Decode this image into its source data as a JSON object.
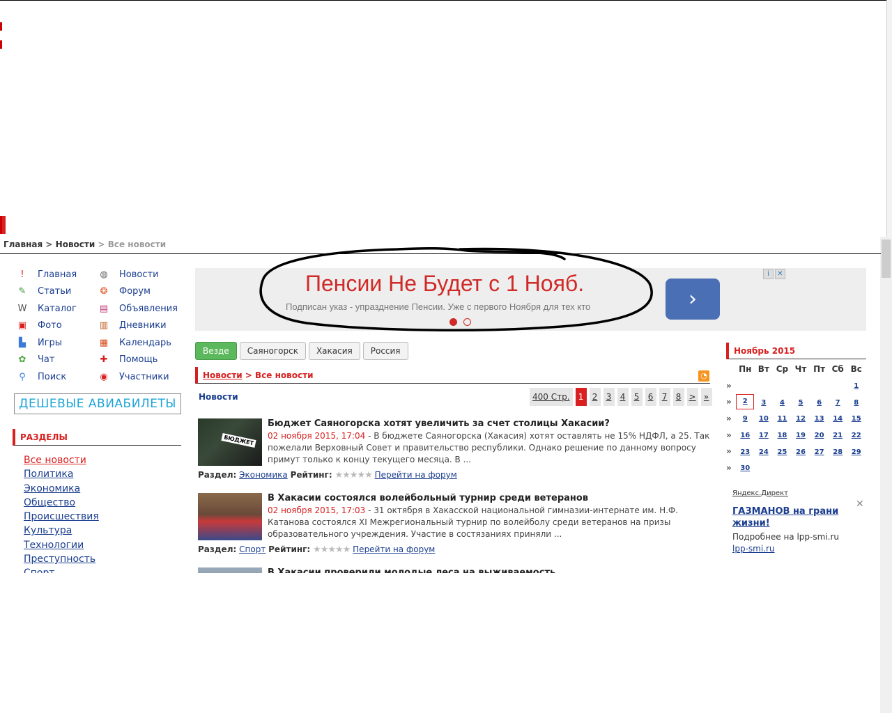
{
  "breadcrumb": {
    "home": "Главная",
    "sep1": ">",
    "news": "Новости",
    "sep2": ">",
    "current": "Все новости"
  },
  "nav": {
    "col1": [
      {
        "label": "Главная",
        "icon": "exclamation-icon",
        "glyph": "!",
        "color": "#d82020"
      },
      {
        "label": "Статьи",
        "icon": "articles-icon",
        "glyph": "✎",
        "color": "#3a9a3a"
      },
      {
        "label": "Каталог",
        "icon": "www-icon",
        "glyph": "W",
        "color": "#555"
      },
      {
        "label": "Фото",
        "icon": "photo-icon",
        "glyph": "▣",
        "color": "#d82020"
      },
      {
        "label": "Игры",
        "icon": "games-icon",
        "glyph": "▙",
        "color": "#3a7ad8"
      },
      {
        "label": "Чат",
        "icon": "chat-icon",
        "glyph": "✿",
        "color": "#4aa83a"
      },
      {
        "label": "Поиск",
        "icon": "search-icon",
        "glyph": "⚲",
        "color": "#3a7ad8"
      }
    ],
    "col2": [
      {
        "label": "Новости",
        "icon": "satellite-icon",
        "glyph": "◍",
        "color": "#666"
      },
      {
        "label": "Форум",
        "icon": "forum-icon",
        "glyph": "❂",
        "color": "#e05a2a"
      },
      {
        "label": "Объявления",
        "icon": "ads-icon",
        "glyph": "▤",
        "color": "#c0387a"
      },
      {
        "label": "Дневники",
        "icon": "diary-icon",
        "glyph": "▥",
        "color": "#c05a1a"
      },
      {
        "label": "Календарь",
        "icon": "calendar-icon",
        "glyph": "▦",
        "color": "#d84a1a"
      },
      {
        "label": "Помощь",
        "icon": "help-icon",
        "glyph": "✚",
        "color": "#d82020"
      },
      {
        "label": "Участники",
        "icon": "users-icon",
        "glyph": "◉",
        "color": "#d82020"
      }
    ]
  },
  "cheap_tickets": "ДЕШЕВЫЕ АВИАБИЛЕТЫ",
  "razdely": {
    "title": "РАЗДЕЛЫ",
    "items": [
      "Все новости",
      "Политика",
      "Экономика",
      "Общество",
      "Происшествия",
      "Культура",
      "Технологии",
      "Преступность",
      "Спорт"
    ]
  },
  "ad": {
    "title": "Пенсии Не Будет с 1 Нояб.",
    "subtitle": "Подписан указ - упразднение Пенсии. Уже с первого Ноября для тех кто",
    "button_glyph": "›",
    "info_glyph": "i",
    "close_glyph": "✕"
  },
  "region_tabs": [
    "Везде",
    "Саяногорск",
    "Хакасия",
    "Россия"
  ],
  "content_header": {
    "news": "Новости",
    "sep": ">",
    "all": "Все новости"
  },
  "news_label": "Новости",
  "pager": {
    "total": "400 Стр.",
    "pages": [
      "1",
      "2",
      "3",
      "4",
      "5",
      "6",
      "7",
      "8"
    ],
    "next": ">",
    "last": "»"
  },
  "news": [
    {
      "title": "Бюджет Саяногорска хотят увеличить за счет столицы Хакасии?",
      "date": "02 ноября 2015, 17:04",
      "text": " - В бюджете Саяногорска (Хакасия) хотят оставлять не 15% НДФЛ, а 25. Так пожелали Верховный Совет и правительство республики. Однако решение по данному вопросу примут только к концу текущего месяца. В ...",
      "section_label": "Раздел:",
      "section": "Экономика",
      "rating_label": "Рейтинг:",
      "forum_link": "Перейти на форум",
      "thumb_text": "БЮДЖЕТ"
    },
    {
      "title": "В Хакасии состоялся волейбольный турнир среди ветеранов",
      "date": "02 ноября 2015, 17:03",
      "text": " - 31 октября в Хакасской национальной гимназии-интернате им. Н.Ф. Катанова состоялся XI Межрегиональный турнир по волейболу среди ветеранов на призы образовательного учреждения. Участие в состязаниях приняли ...",
      "section_label": "Раздел:",
      "section": "Спорт",
      "rating_label": "Рейтинг:",
      "forum_link": "Перейти на форум",
      "thumb_text": ""
    },
    {
      "title": "В Хакасии проверили молодые леса на выживаемость",
      "date": "",
      "text": "",
      "section_label": "",
      "section": "",
      "rating_label": "",
      "forum_link": "",
      "thumb_text": ""
    }
  ],
  "calendar": {
    "title": "Ноябрь 2015",
    "weekdays": [
      "Пн",
      "Вт",
      "Ср",
      "Чт",
      "Пт",
      "Сб",
      "Вс"
    ],
    "arrow": "»",
    "weeks": [
      [
        "",
        "",
        "",
        "",
        "",
        "",
        "1"
      ],
      [
        "2",
        "3",
        "4",
        "5",
        "6",
        "7",
        "8"
      ],
      [
        "9",
        "10",
        "11",
        "12",
        "13",
        "14",
        "15"
      ],
      [
        "16",
        "17",
        "18",
        "19",
        "20",
        "21",
        "22"
      ],
      [
        "23",
        "24",
        "25",
        "26",
        "27",
        "28",
        "29"
      ],
      [
        "30",
        "",
        "",
        "",
        "",
        "",
        ""
      ]
    ],
    "today": "2"
  },
  "yandex": {
    "label": "Яндекс.Директ",
    "title": "ГАЗМАНОВ на грани жизни!",
    "text": "Подробнее на lpp-smi.ru",
    "link": "lpp-smi.ru",
    "close": "✕"
  },
  "rss_glyph": "◔",
  "colors": {
    "accent": "#d82020",
    "link": "#1a3d8f",
    "green": "#5cb85c",
    "ad_button": "#4a6fb5"
  }
}
